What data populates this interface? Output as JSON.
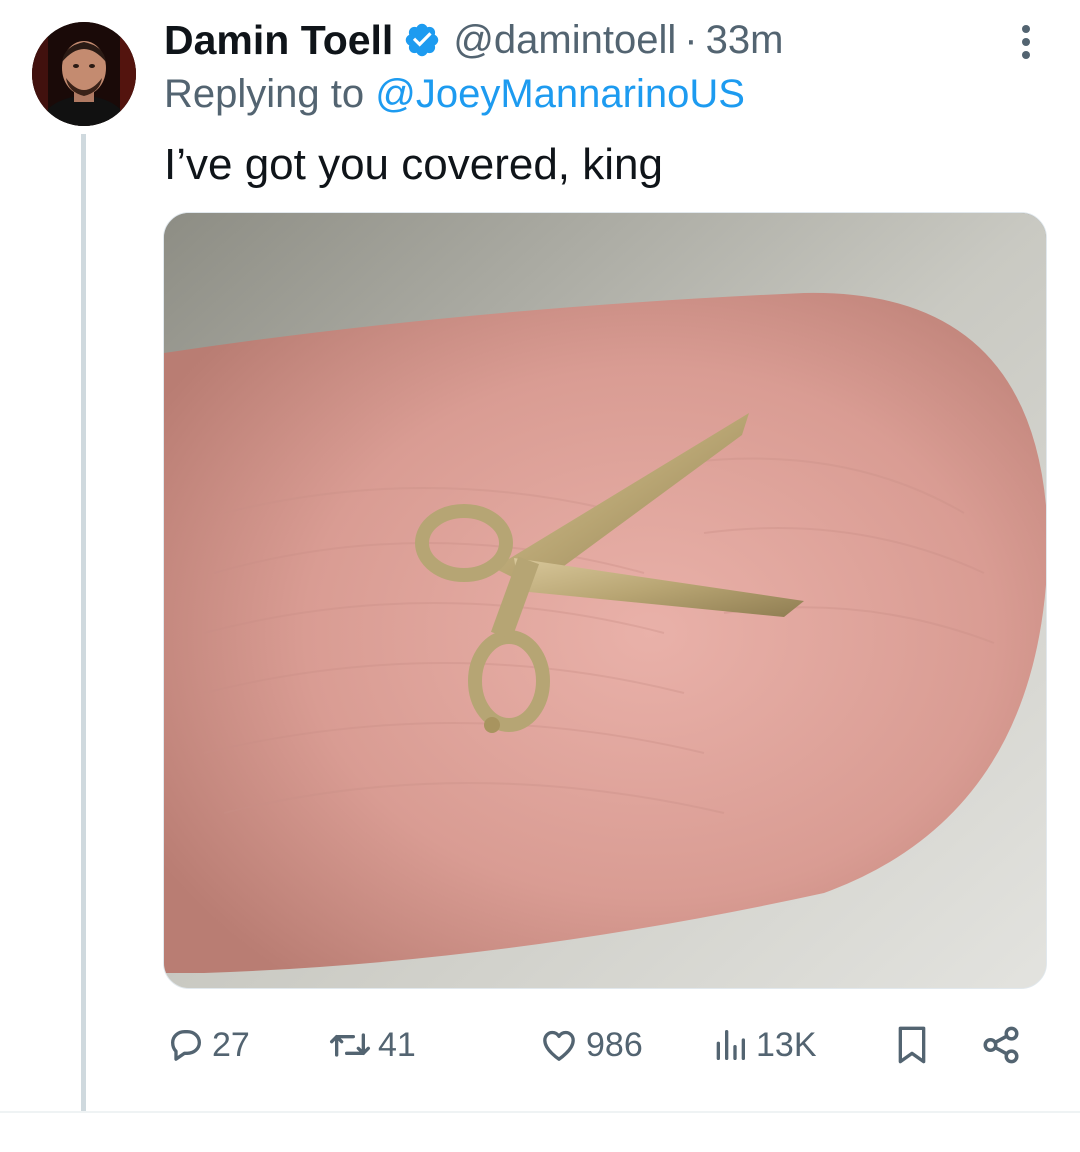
{
  "tweet": {
    "author": {
      "display_name": "Damin Toell",
      "handle": "@damintoell",
      "verified_icon": "verified-badge-icon"
    },
    "separator": "·",
    "time": "33m",
    "reply": {
      "prefix": "Replying to ",
      "mention": "@JoeyMannarinoUS"
    },
    "text": "I’ve got you covered, king",
    "media": {
      "alt": "Tiny gold scissors charm on a fingertip"
    },
    "actions": {
      "replies": "27",
      "retweets": "41",
      "likes": "986",
      "views": "13K"
    }
  },
  "colors": {
    "link": "#1d9bf0",
    "secondary_text": "#536471",
    "verified": "#1d9bf0",
    "thread_line": "#cfd9de"
  },
  "icons": [
    "more-options-icon",
    "verified-badge-icon",
    "reply-icon",
    "retweet-icon",
    "like-icon",
    "views-icon",
    "bookmark-icon",
    "share-icon"
  ]
}
